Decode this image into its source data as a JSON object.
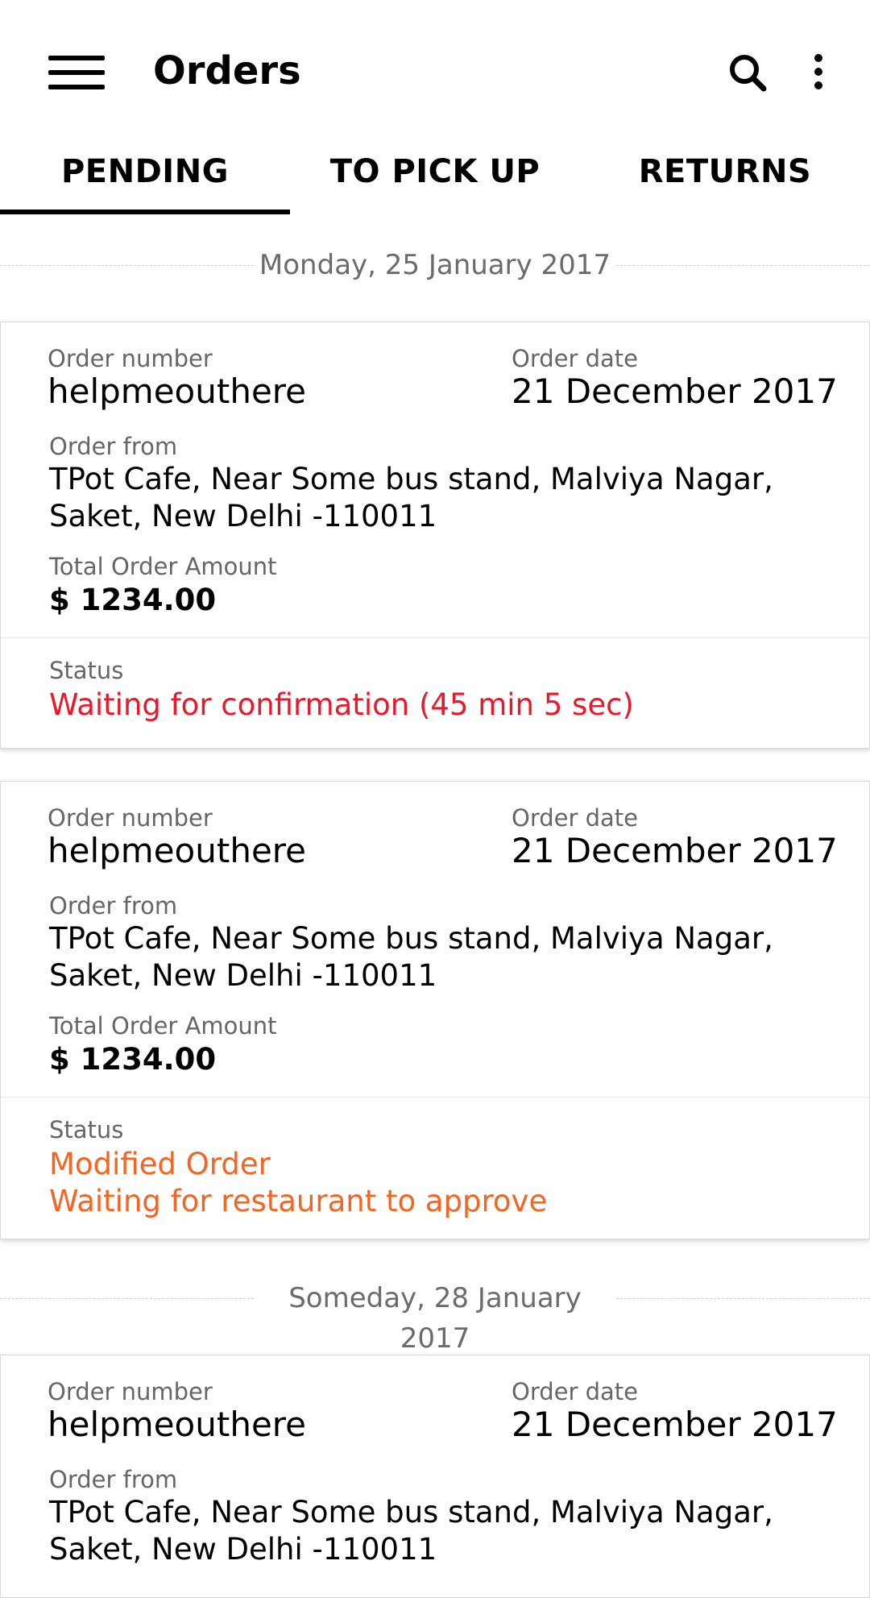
{
  "appbar": {
    "title": "Orders",
    "menu_icon": "hamburger-menu-icon",
    "search_icon": "search-icon",
    "more_icon": "more-vertical-icon"
  },
  "tabs": [
    {
      "label": "PENDING",
      "selected": true
    },
    {
      "label": "TO PICK UP",
      "selected": false
    },
    {
      "label": "RETURNS",
      "selected": false
    }
  ],
  "colors": {
    "status_red": "#e8192c",
    "status_orange": "#f26522"
  },
  "groups": [
    {
      "date": "Monday, 25 January 2017",
      "orders": [
        {
          "order_number_label": "Order number",
          "order_number": "helpmeouthere",
          "order_date_label": "Order date",
          "order_date": "21 December 2017",
          "order_from_label": "Order from",
          "order_from_line1": "TPot Cafe, Near Some bus stand, Malviya Nagar,",
          "order_from_line2": "Saket, New Delhi -110011",
          "total_label": "Total Order Amount",
          "total": "$ 1234.00",
          "status_label": "Status",
          "status_line1": "Waiting for confirmation (45 min 5 sec)",
          "status_line2": ""
        },
        {
          "order_number_label": "Order number",
          "order_number": "helpmeouthere",
          "order_date_label": "Order date",
          "order_date": "21 December 2017",
          "order_from_label": "Order from",
          "order_from_line1": "TPot Cafe, Near Some bus stand, Malviya Nagar,",
          "order_from_line2": "Saket, New Delhi -110011",
          "total_label": "Total Order Amount",
          "total": "$ 1234.00",
          "status_label": "Status",
          "status_line1": "Modified Order",
          "status_line2": "Waiting for restaurant to approve"
        }
      ]
    },
    {
      "date": "Someday, 28 January 2017",
      "orders": [
        {
          "order_number_label": "Order number",
          "order_number": "helpmeouthere",
          "order_date_label": "Order date",
          "order_date": "21 December 2017",
          "order_from_label": "Order from",
          "order_from_line1": "TPot Cafe, Near Some bus stand, Malviya Nagar,",
          "order_from_line2": "Saket, New Delhi -110011"
        }
      ]
    }
  ]
}
